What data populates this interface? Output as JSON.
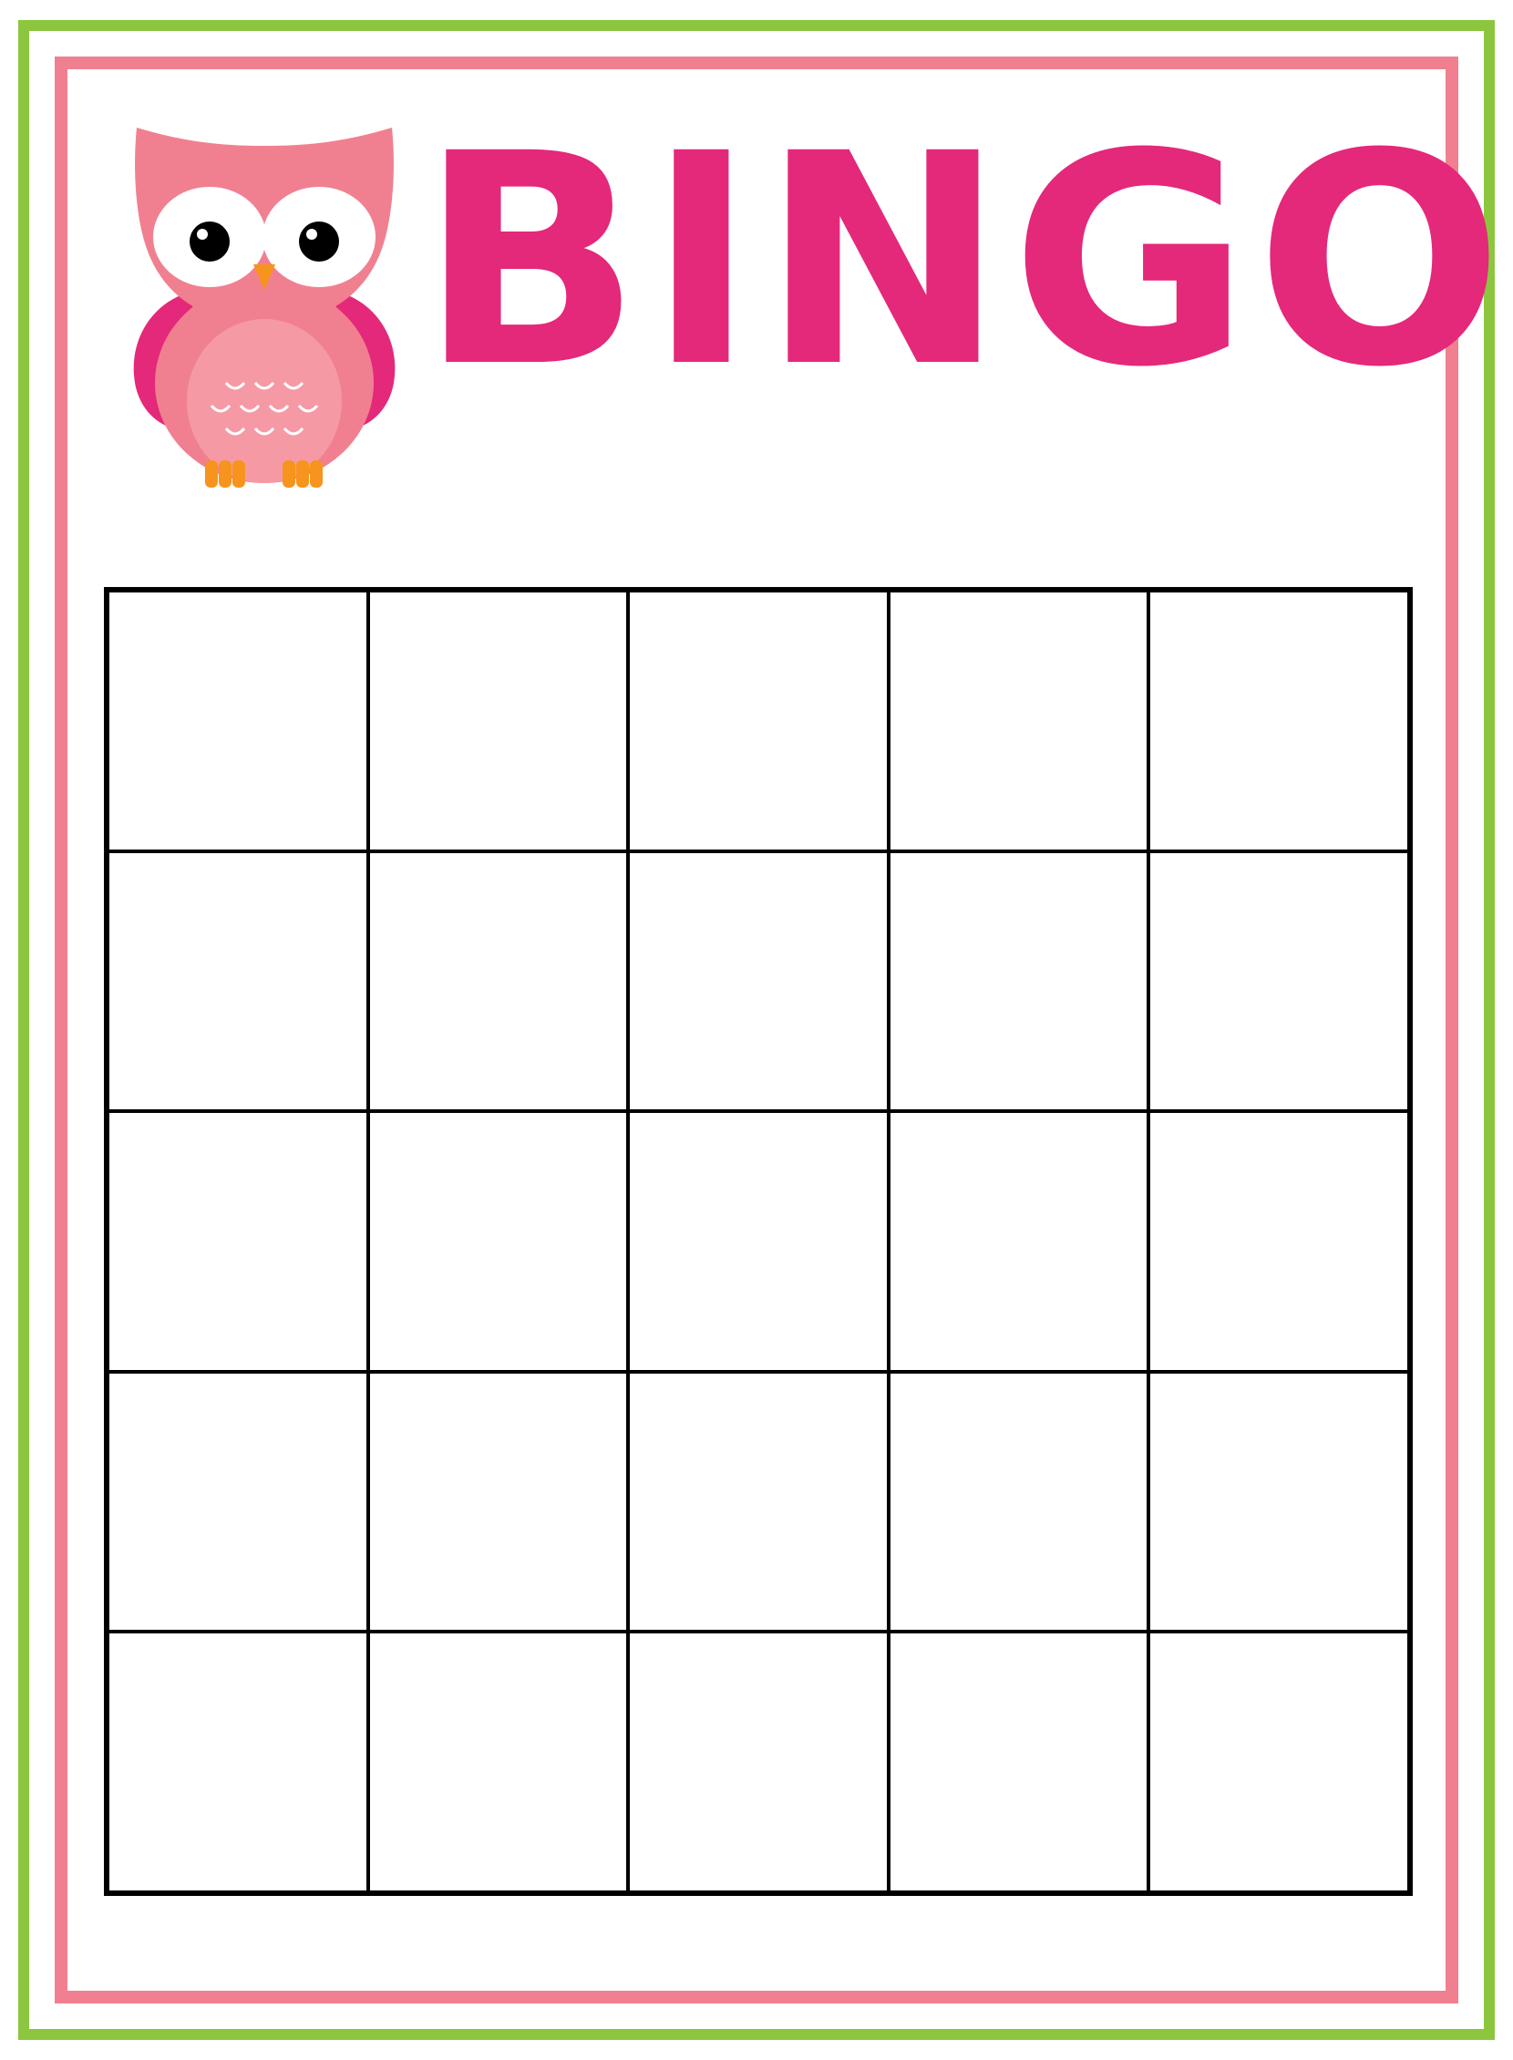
{
  "header": {
    "title": "BINGO",
    "illustration_icon": "owl-icon"
  },
  "grid": {
    "rows": 5,
    "columns": 5,
    "cells": [
      "",
      "",
      "",
      "",
      "",
      "",
      "",
      "",
      "",
      "",
      "",
      "",
      "",
      "",
      "",
      "",
      "",
      "",
      "",
      "",
      "",
      "",
      "",
      "",
      ""
    ]
  },
  "colors": {
    "title": "#e4287a",
    "owl_body": "#f08090",
    "owl_wing": "#e4287a",
    "owl_feet": "#f7941d",
    "outer_border": "#8cc63f",
    "inner_border": "#f08090",
    "grid_lines": "#000000"
  }
}
